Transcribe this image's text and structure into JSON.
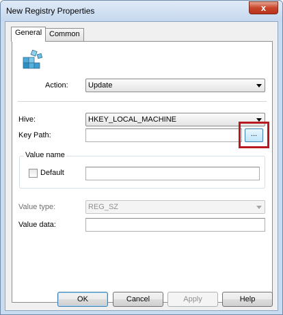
{
  "window": {
    "title": "New Registry Properties",
    "close_glyph": "x"
  },
  "tabs": [
    {
      "label": "General",
      "active": true
    },
    {
      "label": "Common",
      "active": false
    }
  ],
  "general": {
    "action_label": "Action:",
    "action_value": "Update",
    "hive_label": "Hive:",
    "hive_value": "HKEY_LOCAL_MACHINE",
    "key_path_label": "Key Path:",
    "key_path_value": "",
    "browse_label": "...",
    "value_name_group": "Value name",
    "default_label": "Default",
    "default_checked": false,
    "value_name_value": "",
    "value_type_label": "Value type:",
    "value_type_value": "REG_SZ",
    "value_data_label": "Value data:",
    "value_data_value": ""
  },
  "buttons": {
    "ok": "OK",
    "cancel": "Cancel",
    "apply": "Apply",
    "help": "Help"
  },
  "colors": {
    "highlight": "#b8191e",
    "accent": "#3c7fb1"
  },
  "icons": {
    "app": "registry-cubes-icon",
    "dropdown": "chevron-down-icon",
    "close": "close-icon"
  }
}
